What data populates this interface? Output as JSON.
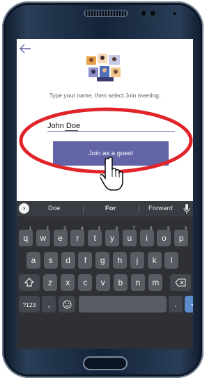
{
  "screen": {
    "instruction_text": "Type your name, then select Join meeting.",
    "name_value": "John Doe",
    "join_button_label": "Join as a guest"
  },
  "keyboard": {
    "suggestions": [
      "Doe",
      "For",
      "Forward"
    ],
    "row1": [
      {
        "key": "q",
        "num": "1"
      },
      {
        "key": "w",
        "num": "2"
      },
      {
        "key": "e",
        "num": "3"
      },
      {
        "key": "r",
        "num": "4"
      },
      {
        "key": "t",
        "num": "5"
      },
      {
        "key": "y",
        "num": "6"
      },
      {
        "key": "u",
        "num": "7"
      },
      {
        "key": "i",
        "num": "8"
      },
      {
        "key": "o",
        "num": "9"
      },
      {
        "key": "p",
        "num": "0"
      }
    ],
    "row2": [
      "a",
      "s",
      "d",
      "f",
      "g",
      "h",
      "j",
      "k",
      "l"
    ],
    "row3": [
      "z",
      "x",
      "c",
      "v",
      "b",
      "n",
      "m"
    ],
    "symbols_key": "?123",
    "comma_key": ",",
    "period_key": ".",
    "shift_icon": "shift-icon",
    "backspace_icon": "backspace-icon",
    "emoji_icon": "emoji-icon",
    "enter_icon": "check-icon"
  },
  "colors": {
    "accent": "#6264a7",
    "highlight_ellipse": "#e0242a",
    "keyboard_bg": "#2e3036",
    "enter_key": "#5d8ccb"
  }
}
